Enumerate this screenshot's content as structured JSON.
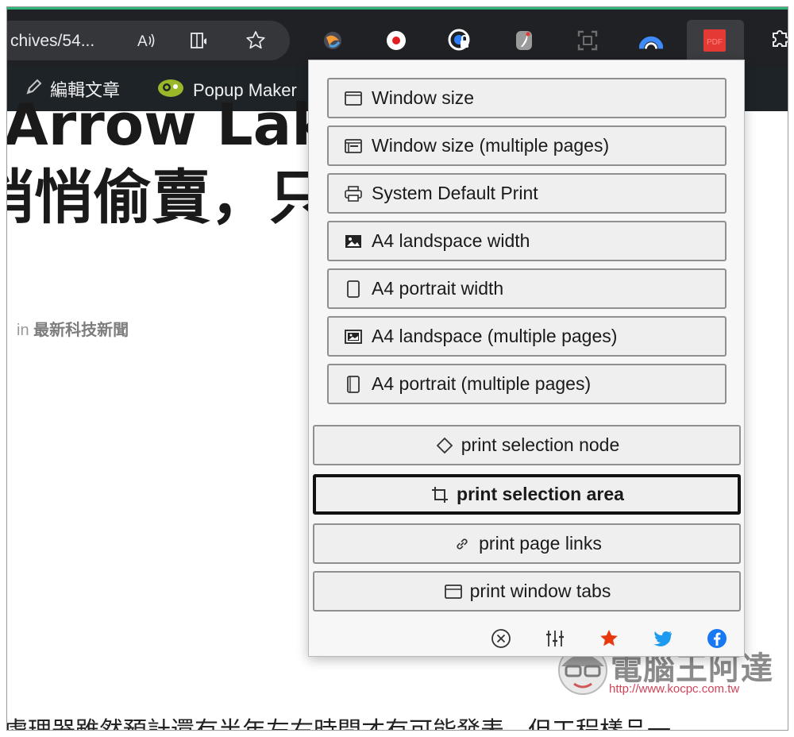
{
  "browser": {
    "address_text": "chives/54...",
    "icons": [
      "read-aloud-icon",
      "immersive-reader-icon",
      "favorite-star-icon"
    ],
    "extensions": [
      "ext-swirl-icon",
      "ext-record-icon",
      "ext-lock-icon",
      "ext-feather-icon",
      "ext-capture-icon",
      "ext-arc-icon",
      "ext-pdf-icon",
      "extensions-puzzle-icon"
    ],
    "active_extension_label": "PDF"
  },
  "wp_admin_bar": {
    "edit_label": "編輯文章",
    "popup_maker_label": "Popup Maker"
  },
  "article": {
    "headline_line1": "Arrow Lake",
    "headline_line2": "悄悄偷賣，只",
    "meta_prefix": "in",
    "category": "最新科技新聞",
    "body_fragment": "處理器雖然預計還有半年左右時間才有可能發表，但工程樣品一"
  },
  "popup": {
    "print_options": [
      {
        "label": "Window size",
        "icon": "window-icon"
      },
      {
        "label": "Window size (multiple pages)",
        "icon": "window-stack-icon"
      },
      {
        "label": "System Default Print",
        "icon": "printer-icon"
      },
      {
        "label": "A4 landspace width",
        "icon": "image-landscape-icon"
      },
      {
        "label": "A4 portrait width",
        "icon": "page-portrait-icon"
      },
      {
        "label": "A4 landspace (multiple pages)",
        "icon": "image-stack-icon"
      },
      {
        "label": "A4 portrait (multiple pages)",
        "icon": "page-stack-icon"
      }
    ],
    "wide_actions": [
      {
        "label": "print selection node",
        "icon": "eraser-icon"
      },
      {
        "label": "print selection area",
        "icon": "crop-icon",
        "focused": true
      },
      {
        "label": "print page links",
        "icon": "link-icon"
      },
      {
        "label": "print window tabs",
        "icon": "window-tab-icon"
      }
    ],
    "footer_icons": [
      "close-circle-icon",
      "settings-sliders-icon",
      "rate-star-icon",
      "twitter-icon",
      "facebook-icon"
    ]
  },
  "watermark": {
    "title": "電腦王阿達",
    "url": "http://www.kocpc.com.tw"
  },
  "colors": {
    "toolbar": "#202124",
    "address_bar": "#35363a",
    "wp_admin_bar": "#1d2327",
    "popup_bg": "#f7f7f7",
    "pdf_ext_red": "#e53935",
    "accent_green": "#2fb67a"
  }
}
